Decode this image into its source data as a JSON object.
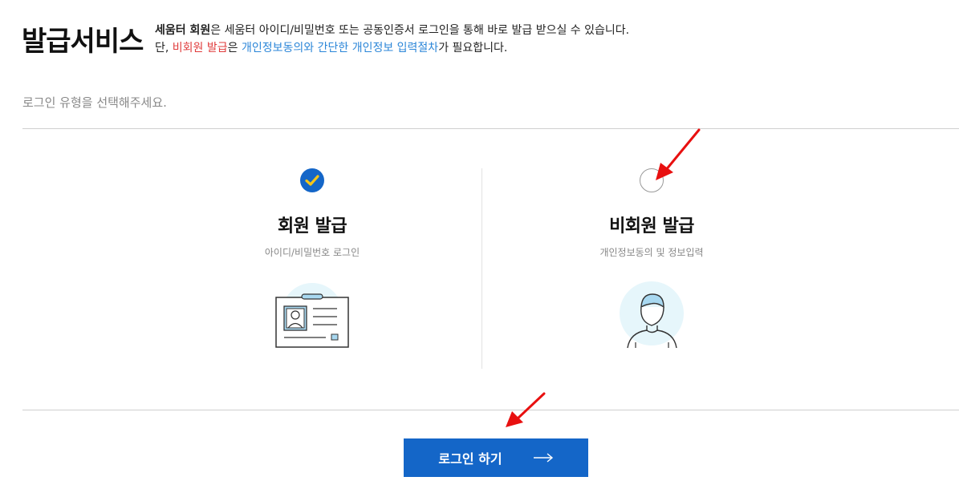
{
  "page_title": "발급서비스",
  "intro": {
    "line1_strong": "세움터 회원",
    "line1_rest": "은 세움터 아이디/비밀번호 또는 공동인증서 로그인을 통해 바로 발급 받으실 수 있습니다.",
    "line2_prefix": "단, ",
    "line2_red": "비회원 발급",
    "line2_mid1": "은 ",
    "line2_blue1": "개인정보동의와",
    "line2_mid2": " ",
    "line2_blue2": "간단한 개인정보 입력절차",
    "line2_suffix": "가 필요합니다."
  },
  "guide_text": "로그인 유형을 선택해주세요.",
  "options": [
    {
      "title": "회원 발급",
      "subtitle": "아이디/비밀번호 로그인",
      "selected": true,
      "icon": "id-card-icon"
    },
    {
      "title": "비회원 발급",
      "subtitle": "개인정보동의 및 정보입력",
      "selected": false,
      "icon": "person-icon"
    }
  ],
  "login_button": {
    "label": "로그인 하기",
    "icon": "arrow-right-icon"
  },
  "colors": {
    "brand_blue": "#1466c8",
    "check_yellow": "#f5c518",
    "red_text": "#e03c3c",
    "blue_text": "#2b86d8",
    "annotation_red": "#e81010",
    "illustration_bg": "#e6f6fb"
  }
}
